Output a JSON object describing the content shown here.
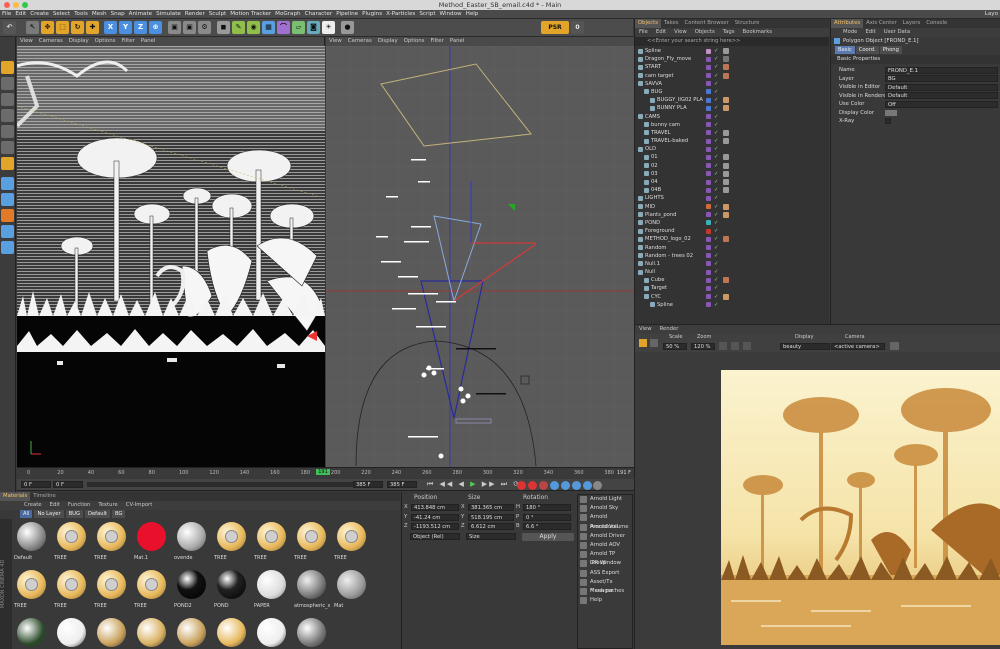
{
  "window": {
    "title": "Method_Easter_SB_email.c4d * - Main"
  },
  "menubar": [
    "File",
    "Edit",
    "Create",
    "Select",
    "Tools",
    "Mesh",
    "Snap",
    "Animate",
    "Simulate",
    "Render",
    "Sculpt",
    "Motion Tracker",
    "MoGraph",
    "Character",
    "Pipeline",
    "Plugins",
    "X-Particles",
    "Script",
    "Window",
    "Help"
  ],
  "layout_label": "Layo",
  "viewport_left": {
    "menu": [
      "View",
      "Cameras",
      "Display",
      "Options",
      "Filter",
      "Panel"
    ]
  },
  "viewport_right": {
    "menu": [
      "View",
      "Cameras",
      "Display",
      "Options",
      "Filter",
      "Panel"
    ]
  },
  "toolbar": {
    "axis_x": "X",
    "axis_y": "Y",
    "axis_z": "Z",
    "psr": "PSR",
    "psr_value": "0"
  },
  "timeline": {
    "ticks": [
      "0",
      "20",
      "40",
      "60",
      "80",
      "100",
      "120",
      "140",
      "160",
      "180",
      "200",
      "220",
      "240",
      "260",
      "280",
      "300",
      "320",
      "340",
      "360",
      "380"
    ],
    "current_frame": "191",
    "end_frame_label": "191 F",
    "start_field": "0 F",
    "min_field": "0 F",
    "max_field": "385 F",
    "max_field2": "385 F"
  },
  "materials": {
    "tabs": [
      "Materials",
      "Timeline"
    ],
    "menu": [
      "Create",
      "Edit",
      "Function",
      "Texture",
      "CV-Import"
    ],
    "filters": [
      "All",
      "No Layer",
      "BUG",
      "Default",
      "BG"
    ],
    "row1": [
      "Default",
      "TREE",
      "TREE",
      "Mat.1",
      "ovende",
      "TREE",
      "TREE",
      "TREE",
      "TREE"
    ],
    "row2": [
      "TREE",
      "TREE",
      "TREE",
      "TREE",
      "POND2",
      "POND",
      "PAPER",
      "atmospheric_sc",
      "Mat"
    ],
    "side_label": "MAXON CINEMA 4D"
  },
  "coords": {
    "headers": [
      "Position",
      "Size",
      "Rotation"
    ],
    "rows": [
      {
        "axis": "X",
        "pos": "413.848 cm",
        "size_axis": "X",
        "size": "381.365 cm",
        "rot_axis": "H",
        "rot": "180 °"
      },
      {
        "axis": "Y",
        "pos": "-41.24 cm",
        "size_axis": "Y",
        "size": "518.195 cm",
        "rot_axis": "P",
        "rot": "0 °"
      },
      {
        "axis": "Z",
        "pos": "-1193.512 cm",
        "size_axis": "Z",
        "size": "6.612 cm",
        "rot_axis": "B",
        "rot": "6.6 °"
      }
    ],
    "mode": "Object (Rel)",
    "size_mode": "Size",
    "apply": "Apply"
  },
  "plugins_menu": [
    "Arnold Light",
    "Arnold Sky",
    "Arnold Procedural",
    "Arnold Volume",
    "Arnold Driver",
    "Arnold AOV",
    "Arnold TP Group",
    "IPR Window",
    "ASS Export",
    "Asset/Tx Manager",
    "Flush caches",
    "Help"
  ],
  "objects": {
    "tabs": [
      "Objects",
      "Takes",
      "Content Browser",
      "Structure"
    ],
    "menu": [
      "File",
      "Edit",
      "View",
      "Objects",
      "Tags",
      "Bookmarks"
    ],
    "search": "<<Enter your search string here>>",
    "items": [
      {
        "name": "Spline",
        "indent": 0,
        "color": "#c58fc8",
        "tagColor": "#999"
      },
      {
        "name": "Dragon_Fly_move",
        "indent": 0,
        "color": "#8a56b8",
        "tagColor": "#777"
      },
      {
        "name": "START",
        "indent": 0,
        "color": "#8a56b8",
        "tagColor": "#b75"
      },
      {
        "name": "cam target",
        "indent": 0,
        "color": "#8a56b8",
        "tagColor": "#b75"
      },
      {
        "name": "SAVVA",
        "indent": 0,
        "color": "#8a56b8",
        "tagColor": ""
      },
      {
        "name": "BUG",
        "indent": 1,
        "color": "#4a7ad8",
        "tagColor": ""
      },
      {
        "name": "BUGGY_IIG02 PLA",
        "indent": 2,
        "color": "#4a7ad8",
        "tagColor": "#c96"
      },
      {
        "name": "BUNNY PLA",
        "indent": 2,
        "color": "#4a7ad8",
        "tagColor": "#c96"
      },
      {
        "name": "CAMS",
        "indent": 0,
        "color": "#8a56b8",
        "tagColor": ""
      },
      {
        "name": "bunny cam",
        "indent": 1,
        "color": "#8a56b8",
        "tagColor": ""
      },
      {
        "name": "TRAVEL",
        "indent": 1,
        "color": "#8a56b8",
        "tagColor": "#999"
      },
      {
        "name": "TRAVEL-baked",
        "indent": 1,
        "color": "#8a56b8",
        "tagColor": "#999"
      },
      {
        "name": "OLD",
        "indent": 0,
        "color": "#8a56b8",
        "tagColor": ""
      },
      {
        "name": "01",
        "indent": 1,
        "color": "#8a56b8",
        "tagColor": "#999"
      },
      {
        "name": "02",
        "indent": 1,
        "color": "#8a56b8",
        "tagColor": "#999"
      },
      {
        "name": "03",
        "indent": 1,
        "color": "#8a56b8",
        "tagColor": "#999"
      },
      {
        "name": "04",
        "indent": 1,
        "color": "#8a56b8",
        "tagColor": "#999"
      },
      {
        "name": "04B",
        "indent": 1,
        "color": "#8a56b8",
        "tagColor": "#999"
      },
      {
        "name": "LIGHTS",
        "indent": 0,
        "color": "#8a56b8",
        "tagColor": ""
      },
      {
        "name": "MID",
        "indent": 0,
        "color": "#d06a3a",
        "tagColor": "#c96"
      },
      {
        "name": "Plants_pond",
        "indent": 0,
        "color": "#8a56b8",
        "tagColor": "#c96"
      },
      {
        "name": "POND",
        "indent": 0,
        "color": "#3ab0b8",
        "tagColor": ""
      },
      {
        "name": "Foreground",
        "indent": 0,
        "color": "#c0392b",
        "tagColor": ""
      },
      {
        "name": "METHOD_logo_02",
        "indent": 0,
        "color": "#8a56b8",
        "tagColor": "#b75"
      },
      {
        "name": "Random",
        "indent": 0,
        "color": "#8a56b8",
        "tagColor": ""
      },
      {
        "name": "Random - trees 02",
        "indent": 0,
        "color": "#8a56b8",
        "tagColor": ""
      },
      {
        "name": "Null.1",
        "indent": 0,
        "color": "#8a56b8",
        "tagColor": ""
      },
      {
        "name": "Null",
        "indent": 0,
        "color": "#8a56b8",
        "tagColor": ""
      },
      {
        "name": "Cube",
        "indent": 1,
        "color": "#8a56b8",
        "tagColor": "#b75"
      },
      {
        "name": "Target",
        "indent": 1,
        "color": "#8a56b8",
        "tagColor": ""
      },
      {
        "name": "CYC",
        "indent": 1,
        "color": "#8a56b8",
        "tagColor": "#c96"
      },
      {
        "name": "Spline",
        "indent": 2,
        "color": "#8a56b8",
        "tagColor": ""
      }
    ]
  },
  "attributes": {
    "tabs": [
      "Attributes",
      "Axis Center",
      "Layers",
      "Console"
    ],
    "menu": [
      "Mode",
      "Edit",
      "User Data"
    ],
    "object_title": "Polygon Object [FROND_E.1]",
    "subtabs": [
      "Basic",
      "Coord.",
      "Phong"
    ],
    "section": "Basic Properties",
    "fields": [
      {
        "label": "Name",
        "value": "FROND_E.1"
      },
      {
        "label": "Layer",
        "value": "BG"
      },
      {
        "label": "Visible in Editor",
        "value": "Default"
      },
      {
        "label": "Visible in Renderer",
        "value": "Default"
      },
      {
        "label": "Use Color",
        "value": "Off"
      },
      {
        "label": "Display Color",
        "value": ""
      },
      {
        "label": "X-Ray",
        "value": ""
      }
    ]
  },
  "render_view": {
    "menu": [
      "View",
      "Render"
    ],
    "scale_label": "Scale",
    "scale": "50 %",
    "zoom_label": "Zoom",
    "zoom": "120 %",
    "display_label": "Display",
    "display": "beauty",
    "camera_label": "Camera",
    "camera": "<active camera>"
  }
}
